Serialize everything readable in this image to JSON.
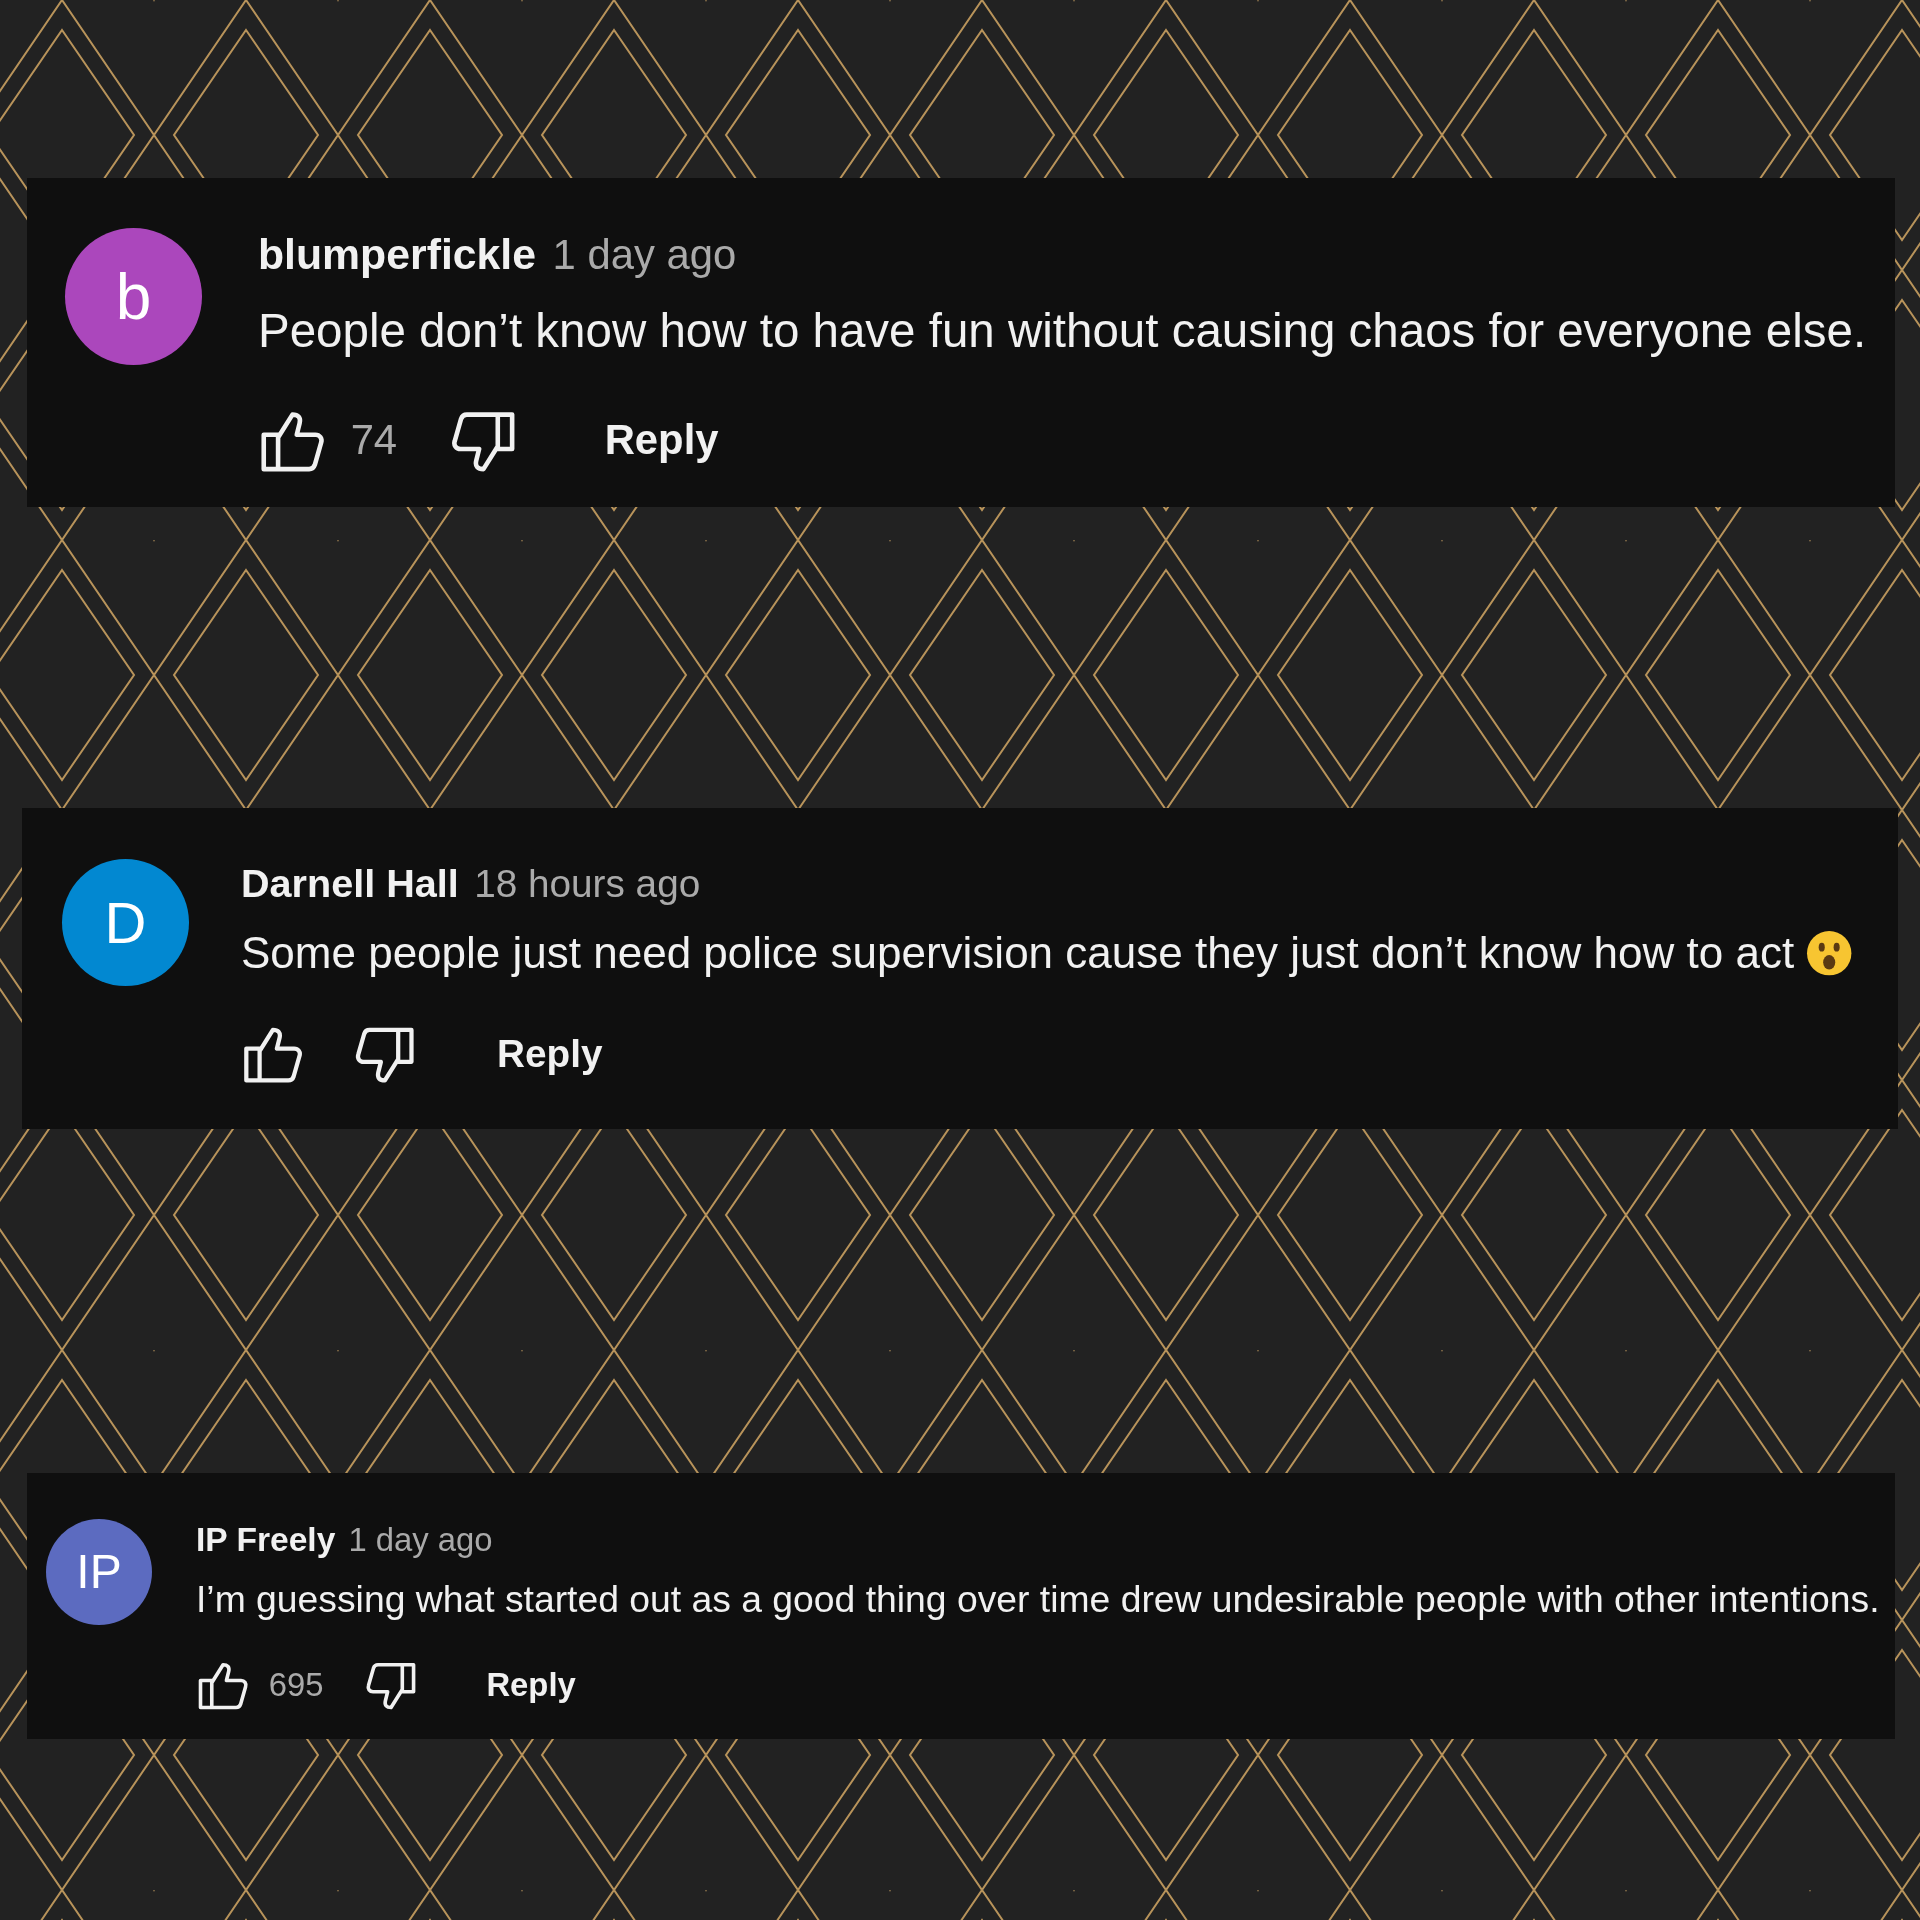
{
  "comments": [
    {
      "author": "blumperfickle",
      "time": "1 day ago",
      "text": "People don’t know how to have fun without causing chaos for everyone else.",
      "avatar": {
        "letter": "b",
        "color": "#ab47bc"
      },
      "likes": "74",
      "reply": "Reply"
    },
    {
      "author": "Darnell Hall",
      "time": "18 hours ago",
      "text": "Some people just need police supervision cause they just don’t know how to act",
      "trailing_icon": {
        "kind": "surprised-emoji"
      },
      "avatar": {
        "letter": "D",
        "color": "#0288d1"
      },
      "reply": "Reply"
    },
    {
      "author": "IP Freely",
      "time": "1 day ago",
      "text": "I’m guessing what started out as a good thing over time drew undesirable people with other intentions.",
      "avatar": {
        "letter": "IP",
        "color": "#5c6bc0"
      },
      "likes": "695",
      "reply": "Reply"
    }
  ]
}
